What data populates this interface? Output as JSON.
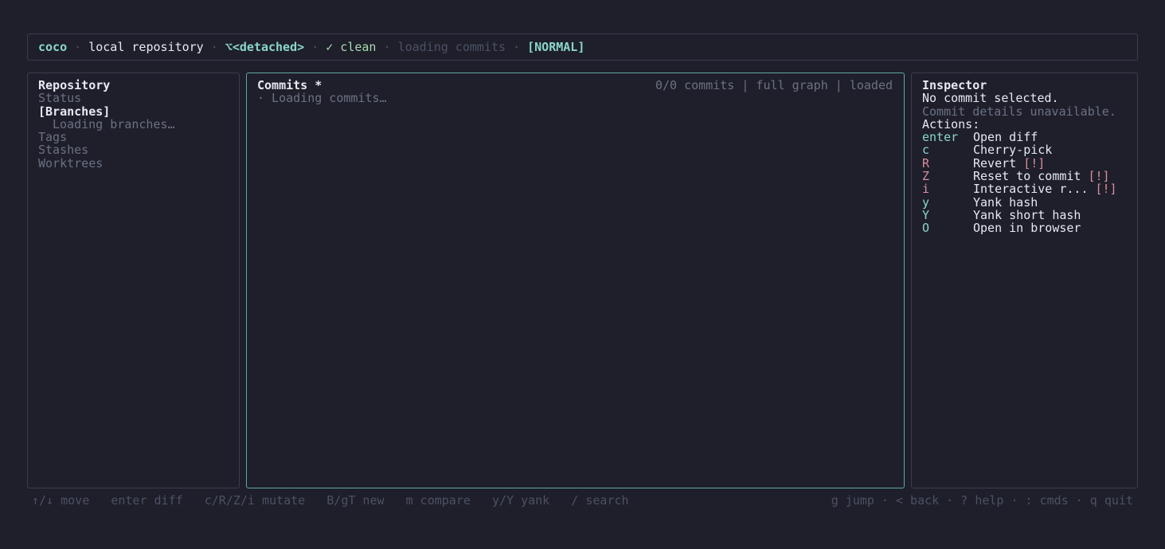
{
  "topbar": {
    "app": "coco",
    "sep": "·",
    "repo": "local repository",
    "branch": "⌥<detached>",
    "clean": "✓ clean",
    "loading": "loading commits",
    "mode": "[NORMAL]"
  },
  "sidebar": {
    "title": "Repository",
    "items": [
      {
        "label": "Status"
      },
      {
        "label": "[Branches]"
      },
      {
        "label": "Loading branches…"
      },
      {
        "label": "Tags"
      },
      {
        "label": "Stashes"
      },
      {
        "label": "Worktrees"
      }
    ]
  },
  "commits": {
    "title": "Commits *",
    "stats": "0/0 commits | full graph | loaded",
    "loading": "· Loading commits…"
  },
  "inspector": {
    "title": "Inspector",
    "no_selection": "No commit selected.",
    "unavailable": "Commit details unavailable.",
    "actions_label": "Actions:",
    "warn_marker": "[!]",
    "actions": [
      {
        "key": "enter",
        "label": "Open diff"
      },
      {
        "key": "c",
        "label": "Cherry-pick"
      },
      {
        "key": "R",
        "label": "Revert"
      },
      {
        "key": "Z",
        "label": "Reset to commit"
      },
      {
        "key": "i",
        "label": "Interactive r..."
      },
      {
        "key": "y",
        "label": "Yank hash"
      },
      {
        "key": "Y",
        "label": "Yank short hash"
      },
      {
        "key": "O",
        "label": "Open in browser"
      }
    ]
  },
  "footer": {
    "left": "↑/↓ move   enter diff   c/R/Z/i mutate   B/gT new   m compare   y/Y yank   / search",
    "right": "g jump · < back · ? help · : cmds · q quit"
  },
  "colors": {
    "background": "#1e1f2b",
    "accent": "#8bd6c8",
    "clean": "#a9dbb0",
    "warning": "#d98e9c",
    "focus_border": "#5fa8a2"
  }
}
